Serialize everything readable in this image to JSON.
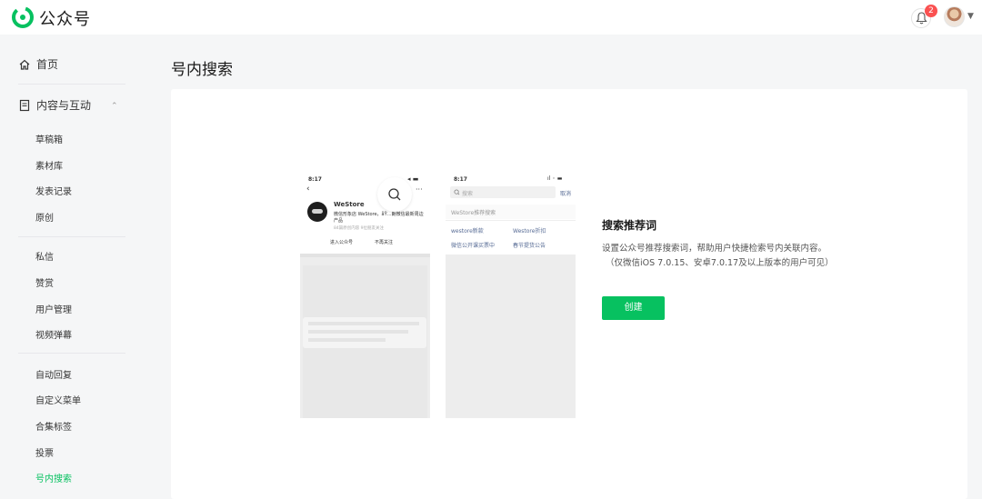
{
  "header": {
    "brand": "公众号",
    "notification_count": "2",
    "accent": "#07c160"
  },
  "sidebar": {
    "home": "首页",
    "content_group": "内容与互动",
    "content_items": [
      "草稿箱",
      "素材库",
      "发表记录",
      "原创"
    ],
    "interact_items": [
      "私信",
      "赞赏",
      "用户管理",
      "视频弹幕"
    ],
    "feature_items": [
      "自动回复",
      "自定义菜单",
      "合集标签",
      "投票",
      "号内搜索"
    ]
  },
  "main": {
    "title": "号内搜索",
    "rec_title": "搜索推荐词",
    "rec_desc_1": "设置公众号推荐搜索词，帮助用户快捷检索号内关联内容。",
    "rec_desc_2": "（仅微信iOS 7.0.15、安卓7.0.17及以上版本的用户可见）",
    "create_label": "创建"
  },
  "phone1": {
    "time": "8:17",
    "account_name": "WeStore",
    "account_desc": "微信形象店 WeStore，åŸ…朗微信最新周边",
    "account_desc2": "产品",
    "follow_info": "84篇原创内容  9位朋友关注",
    "enter_label": "进入公众号",
    "unfollow_label": "不再关注"
  },
  "phone2": {
    "time": "8:17",
    "search_placeholder": "搜索",
    "cancel_label": "取消",
    "section_title": "WeStore推荐搜索",
    "keywords": [
      "westore新款",
      "Westore折扣",
      "微信公开课买票中",
      "春节提货公告"
    ]
  }
}
